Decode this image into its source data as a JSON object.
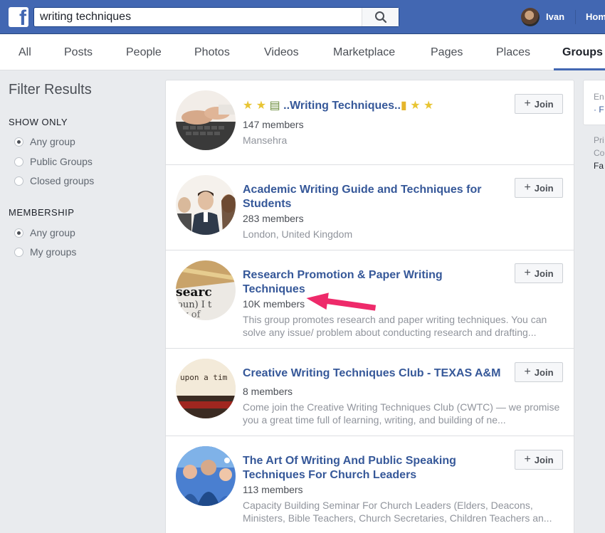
{
  "topbar": {
    "logo_letter": "f",
    "search_value": "writing techniques",
    "user_name": "Ivan",
    "home_label": "Home"
  },
  "tabs": [
    "All",
    "Posts",
    "People",
    "Photos",
    "Videos",
    "Marketplace",
    "Pages",
    "Places",
    "Groups"
  ],
  "active_tab": "Groups",
  "filters": {
    "title": "Filter Results",
    "show_only": {
      "heading": "SHOW ONLY",
      "options": [
        "Any group",
        "Public Groups",
        "Closed groups"
      ],
      "selected": "Any group"
    },
    "membership": {
      "heading": "MEMBERSHIP",
      "options": [
        "Any group",
        "My groups"
      ],
      "selected": "Any group"
    }
  },
  "results": [
    {
      "title": "..Writing Techniques..",
      "members": "147 members",
      "subtitle": "Mansehra",
      "join_label": "Join"
    },
    {
      "title": "Academic Writing Guide and Techniques for Students",
      "members": "283 members",
      "subtitle": "London, United Kingdom",
      "join_label": "Join"
    },
    {
      "title": "Research Promotion & Paper Writing Techniques",
      "members": "10K members",
      "subtitle": "This group promotes research and paper writing techniques. You can solve any issue/ problem about conducting research and drafting...",
      "join_label": "Join"
    },
    {
      "title": "Creative Writing Techniques Club - TEXAS A&M",
      "members": "8 members",
      "subtitle": "Come join the Creative Writing Techniques Club (CWTC) — we promise you a great time full of learning, writing, and building of ne...",
      "join_label": "Join"
    },
    {
      "title": "The Art Of Writing And Public Speaking Techniques For Church Leaders",
      "members": "113 members",
      "subtitle": "Capacity Building Seminar For Church Leaders (Elders, Deacons, Ministers, Bible Teachers, Church Secretaries, Children Teachers an...",
      "join_label": "Join"
    }
  ],
  "right_panel": {
    "line1": "En",
    "line2": "· F",
    "line3": "Pri",
    "line4": "Co",
    "line5": "Fa"
  },
  "colors": {
    "brand_blue": "#4267b2",
    "link_blue": "#365899",
    "annotation_arrow": "#ee2a6a"
  }
}
